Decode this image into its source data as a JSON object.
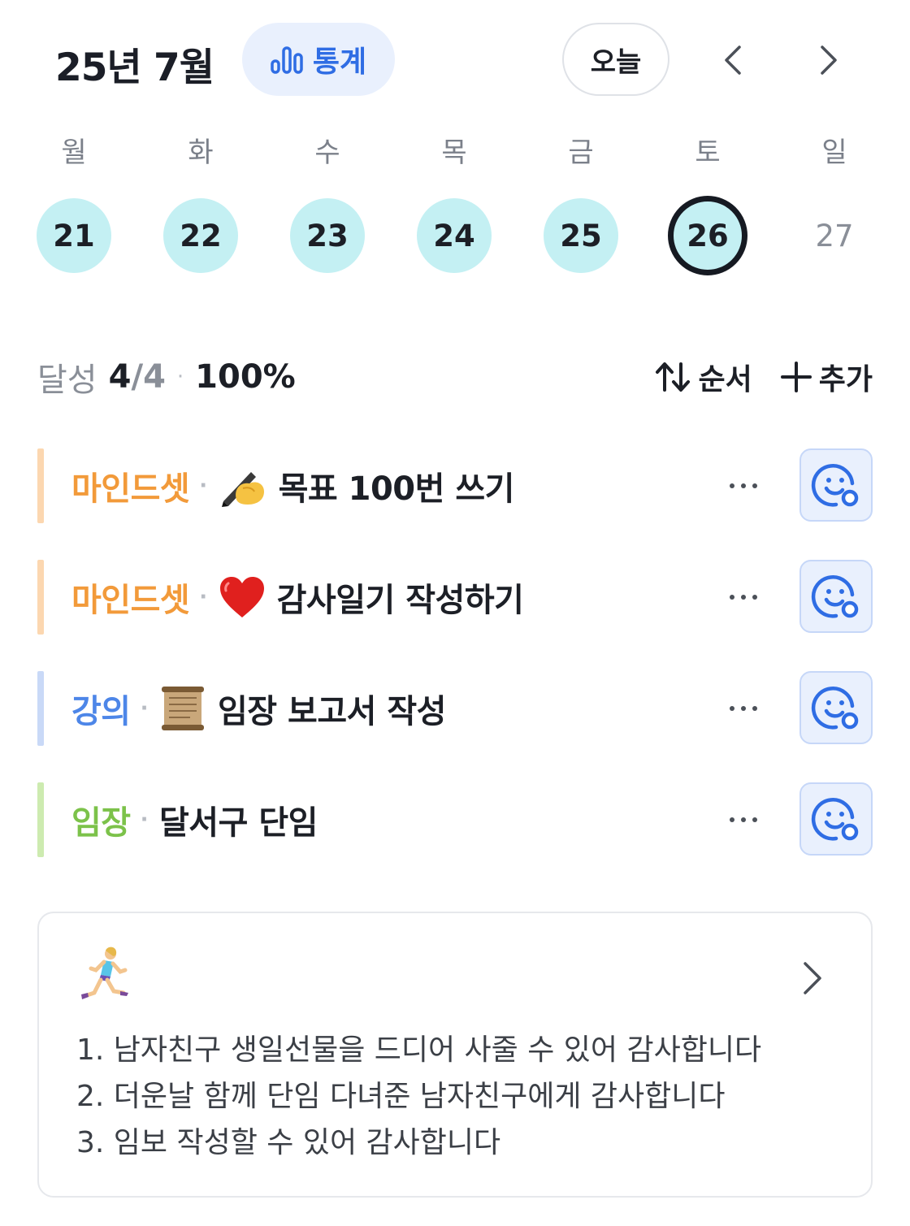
{
  "header": {
    "month_title": "25년 7월",
    "stats_label": "통계",
    "today_label": "오늘",
    "accent_color": "#2f6de4"
  },
  "week": {
    "weekdays": [
      "월",
      "화",
      "수",
      "목",
      "금",
      "토",
      "일"
    ],
    "days": [
      {
        "num": "21",
        "state": "done"
      },
      {
        "num": "22",
        "state": "done"
      },
      {
        "num": "23",
        "state": "done"
      },
      {
        "num": "24",
        "state": "done"
      },
      {
        "num": "25",
        "state": "done"
      },
      {
        "num": "26",
        "state": "selected"
      },
      {
        "num": "27",
        "state": "future"
      }
    ],
    "done_color": "#c4f0f3"
  },
  "summary": {
    "label": "달성",
    "done": "4",
    "total": "/4",
    "separator": "·",
    "percent": "100%",
    "sort_label": "순서",
    "add_label": "추가"
  },
  "habits": [
    {
      "category": "마인드셋",
      "category_color": "#f29a3a",
      "bar_color": "#fcd7b0",
      "emoji": "✍️",
      "emoji_icon": "writing-hand-icon",
      "title": "목표 100번 쓰기"
    },
    {
      "category": "마인드셋",
      "category_color": "#f29a3a",
      "bar_color": "#fcd7b0",
      "emoji": "❤️",
      "emoji_icon": "red-heart-icon",
      "title": "감사일기 작성하기"
    },
    {
      "category": "강의",
      "category_color": "#4d86e8",
      "bar_color": "#c9d9f7",
      "emoji": "📜",
      "emoji_icon": "scroll-icon",
      "title": "임장 보고서 작성"
    },
    {
      "category": "임장",
      "category_color": "#7cc24a",
      "bar_color": "#cdebb0",
      "emoji": "",
      "emoji_icon": "",
      "title": "달서구 단임"
    }
  ],
  "memo": {
    "icon": "woman-running-icon",
    "lines": [
      "1. 남자친구 생일선물을 드디어 사줄 수 있어 감사합니다",
      "2. 더운날 함께 단임 다녀준 남자친구에게 감사합니다",
      "3. 임보 작성할 수 있어 감사합니다"
    ]
  }
}
